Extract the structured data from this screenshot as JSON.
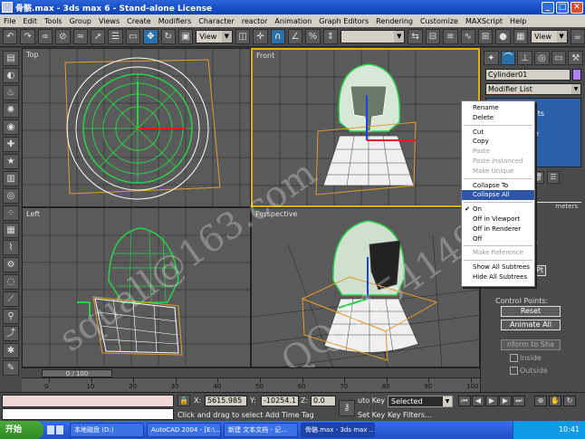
{
  "window": {
    "title": "骨骼.max - 3ds max 6 - Stand-alone License",
    "minimize": "_",
    "maximize": "□",
    "close": "✕"
  },
  "menu": [
    "File",
    "Edit",
    "Tools",
    "Group",
    "Views",
    "Create",
    "Modifiers",
    "Character",
    "reactor",
    "Animation",
    "Graph Editors",
    "Rendering",
    "Customize",
    "MAXScript",
    "Help"
  ],
  "toolbar": {
    "view_select_1": "View",
    "view_select_2": "View",
    "named_sel": ""
  },
  "viewports": {
    "top": "Top",
    "front": "Front",
    "left": "Left",
    "perspective": "Perspective"
  },
  "context_menu": {
    "items": [
      {
        "label": "Rename",
        "state": "normal"
      },
      {
        "label": "Delete",
        "state": "normal"
      },
      {
        "sep": true
      },
      {
        "label": "Cut",
        "state": "normal"
      },
      {
        "label": "Copy",
        "state": "normal"
      },
      {
        "label": "Paste",
        "state": "disabled"
      },
      {
        "label": "Paste Instanced",
        "state": "disabled"
      },
      {
        "label": "Make Unique",
        "state": "disabled"
      },
      {
        "sep": true
      },
      {
        "label": "Collapse To",
        "state": "normal"
      },
      {
        "label": "Collapse All",
        "state": "highlight"
      },
      {
        "sep": true
      },
      {
        "label": "On",
        "state": "checked"
      },
      {
        "label": "Off in Viewport",
        "state": "normal"
      },
      {
        "label": "Off in Renderer",
        "state": "normal"
      },
      {
        "label": "Off",
        "state": "normal"
      },
      {
        "sep": true
      },
      {
        "label": "Make Reference",
        "state": "disabled"
      },
      {
        "sep": true
      },
      {
        "label": "Show All Subtrees",
        "state": "normal"
      },
      {
        "label": "Hide All Subtrees",
        "state": "normal"
      }
    ]
  },
  "command_panel": {
    "object_name": "Cylinder01",
    "modifier_list": "Modifier List",
    "stack_rows": [
      "2",
      "Points",
      "",
      "ume"
    ],
    "rollout_title": "meters",
    "param_text_1": "c",
    "param_text_2": "e",
    "param_text_3": "Pt",
    "control_points_label": "Control Points:",
    "reset_button": "Reset",
    "animate_all_button": "Animate All",
    "conform_button": "nform to Sha",
    "inside_label": "Inside",
    "outside_label": "Outside"
  },
  "timeline": {
    "frame_display": "0 / 100",
    "ticks": [
      "0",
      "10",
      "20",
      "30",
      "40",
      "50",
      "60",
      "70",
      "80",
      "90",
      "100"
    ]
  },
  "status": {
    "x_label": "X:",
    "x_value": "5615.985",
    "y_label": "Y:",
    "y_value": "-10254.1",
    "z_label": "Z:",
    "z_value": "0.0",
    "prompt": "Click and drag to select Add Time Tag",
    "auto_key": "uto Key",
    "set_key": "Set Key",
    "key_filters": "Key Filters...",
    "selection": "Selected"
  },
  "taskbar": {
    "start": "开始",
    "tasks": [
      "本地磁盘 (D:)",
      "AutoCAD 2004 - [E:\\...",
      "新建 文本文档 - 记...",
      "骨骼.max - 3ds max ..."
    ],
    "clock": "10:41"
  },
  "watermark": {
    "line1": "squall@163.com",
    "line2": "QQ:11541493"
  }
}
